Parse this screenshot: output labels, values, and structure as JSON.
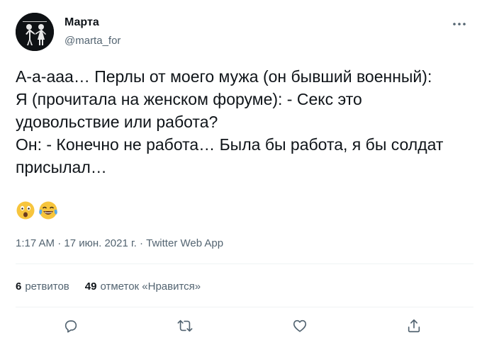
{
  "author": {
    "name": "Марта",
    "handle": "@marta_for"
  },
  "tweet": {
    "text": "А-а-ааа… Перлы от моего мужа (он бывший военный):\nЯ (прочитала на женском форуме): - Секс это удовольствие или работа?\nОн: - Конечно не работа… Была бы работа, я бы солдат присылал…",
    "emojis": [
      "astonished-face",
      "tears-of-joy-face"
    ],
    "timestamp": "1:17 AM · 17 июн. 2021 г. · Twitter Web App"
  },
  "stats": {
    "retweets_count": "6",
    "retweets_label": "ретвитов",
    "likes_count": "49",
    "likes_label": "отметок «Нравится»"
  },
  "icons": {
    "more": "more-horizontal-icon",
    "reply": "reply-icon",
    "retweet": "retweet-icon",
    "like": "heart-icon",
    "share": "share-icon"
  },
  "colors": {
    "text": "#0f1419",
    "secondary": "#536471",
    "divider": "#eff3f4"
  }
}
